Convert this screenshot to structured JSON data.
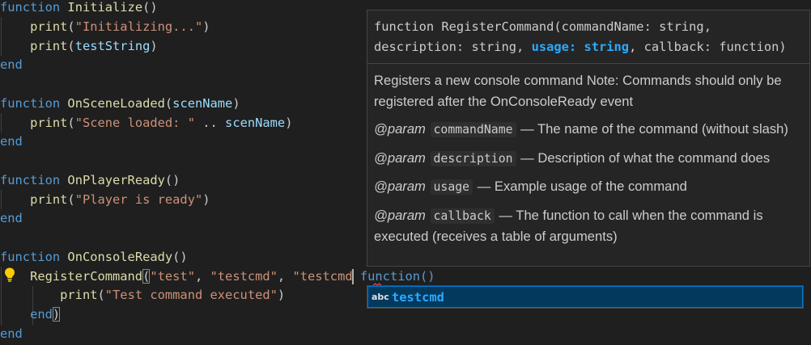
{
  "code": {
    "kw_function": "function",
    "kw_end": "end",
    "l1_name": "Initialize",
    "l1_params": "()",
    "l2_print": "print",
    "l2_open": "(",
    "l2_str": "\"Initializing...\"",
    "l2_close": ")",
    "l3_print": "print",
    "l3_open": "(",
    "l3_var": "testString",
    "l3_close": ")",
    "l6_name": "OnSceneLoaded",
    "l6_open": "(",
    "l6_param": "scenName",
    "l6_close": ")",
    "l7_print": "print",
    "l7_open": "(",
    "l7_str": "\"Scene loaded: \"",
    "l7_concat": " .. ",
    "l7_var": "scenName",
    "l7_close": ")",
    "l10_name": "OnPlayerReady",
    "l10_params": "()",
    "l11_print": "print",
    "l11_open": "(",
    "l11_str": "\"Player is ready\"",
    "l11_close": ")",
    "l14_name": "OnConsoleReady",
    "l14_params": "()",
    "l15_call": "RegisterCommand",
    "l15_open": "(",
    "l15_str1": "\"test\"",
    "l15_comma1": ", ",
    "l15_str2": "\"testcmd\"",
    "l15_comma2": ", ",
    "l15_str3": "\"testcmd",
    "l15_after": " function()",
    "l16_print": "print",
    "l16_open": "(",
    "l16_str": "\"Test command executed\"",
    "l16_close": ")",
    "l17_end": "end",
    "l17_close": ")",
    "l18_end": "end"
  },
  "hover": {
    "sig_line1": "function RegisterCommand(commandName: string,",
    "sig_line2_pre": "description: string, ",
    "sig_line2_active": "usage: string",
    "sig_line2_post": ", callback: function)",
    "description": "Registers a new console command Note: Commands should only be registered after the OnConsoleReady event",
    "param_kw": "@param",
    "params": [
      {
        "name": "commandName",
        "desc": " — The name of the command (without slash)"
      },
      {
        "name": "description",
        "desc": " — Description of what the command does"
      },
      {
        "name": "usage",
        "desc": " — Example usage of the command"
      },
      {
        "name": "callback",
        "desc": " — The function to call when the command is executed (receives a table of arguments)"
      }
    ]
  },
  "suggest": {
    "kind_icon": "abc",
    "label": "testcmd"
  },
  "colors": {
    "background": "#1f1f1f",
    "keyword": "#569cd6",
    "function_name": "#dcdcaa",
    "string": "#ce9178",
    "variable": "#9cdcfe",
    "accent": "#2aaaff"
  }
}
